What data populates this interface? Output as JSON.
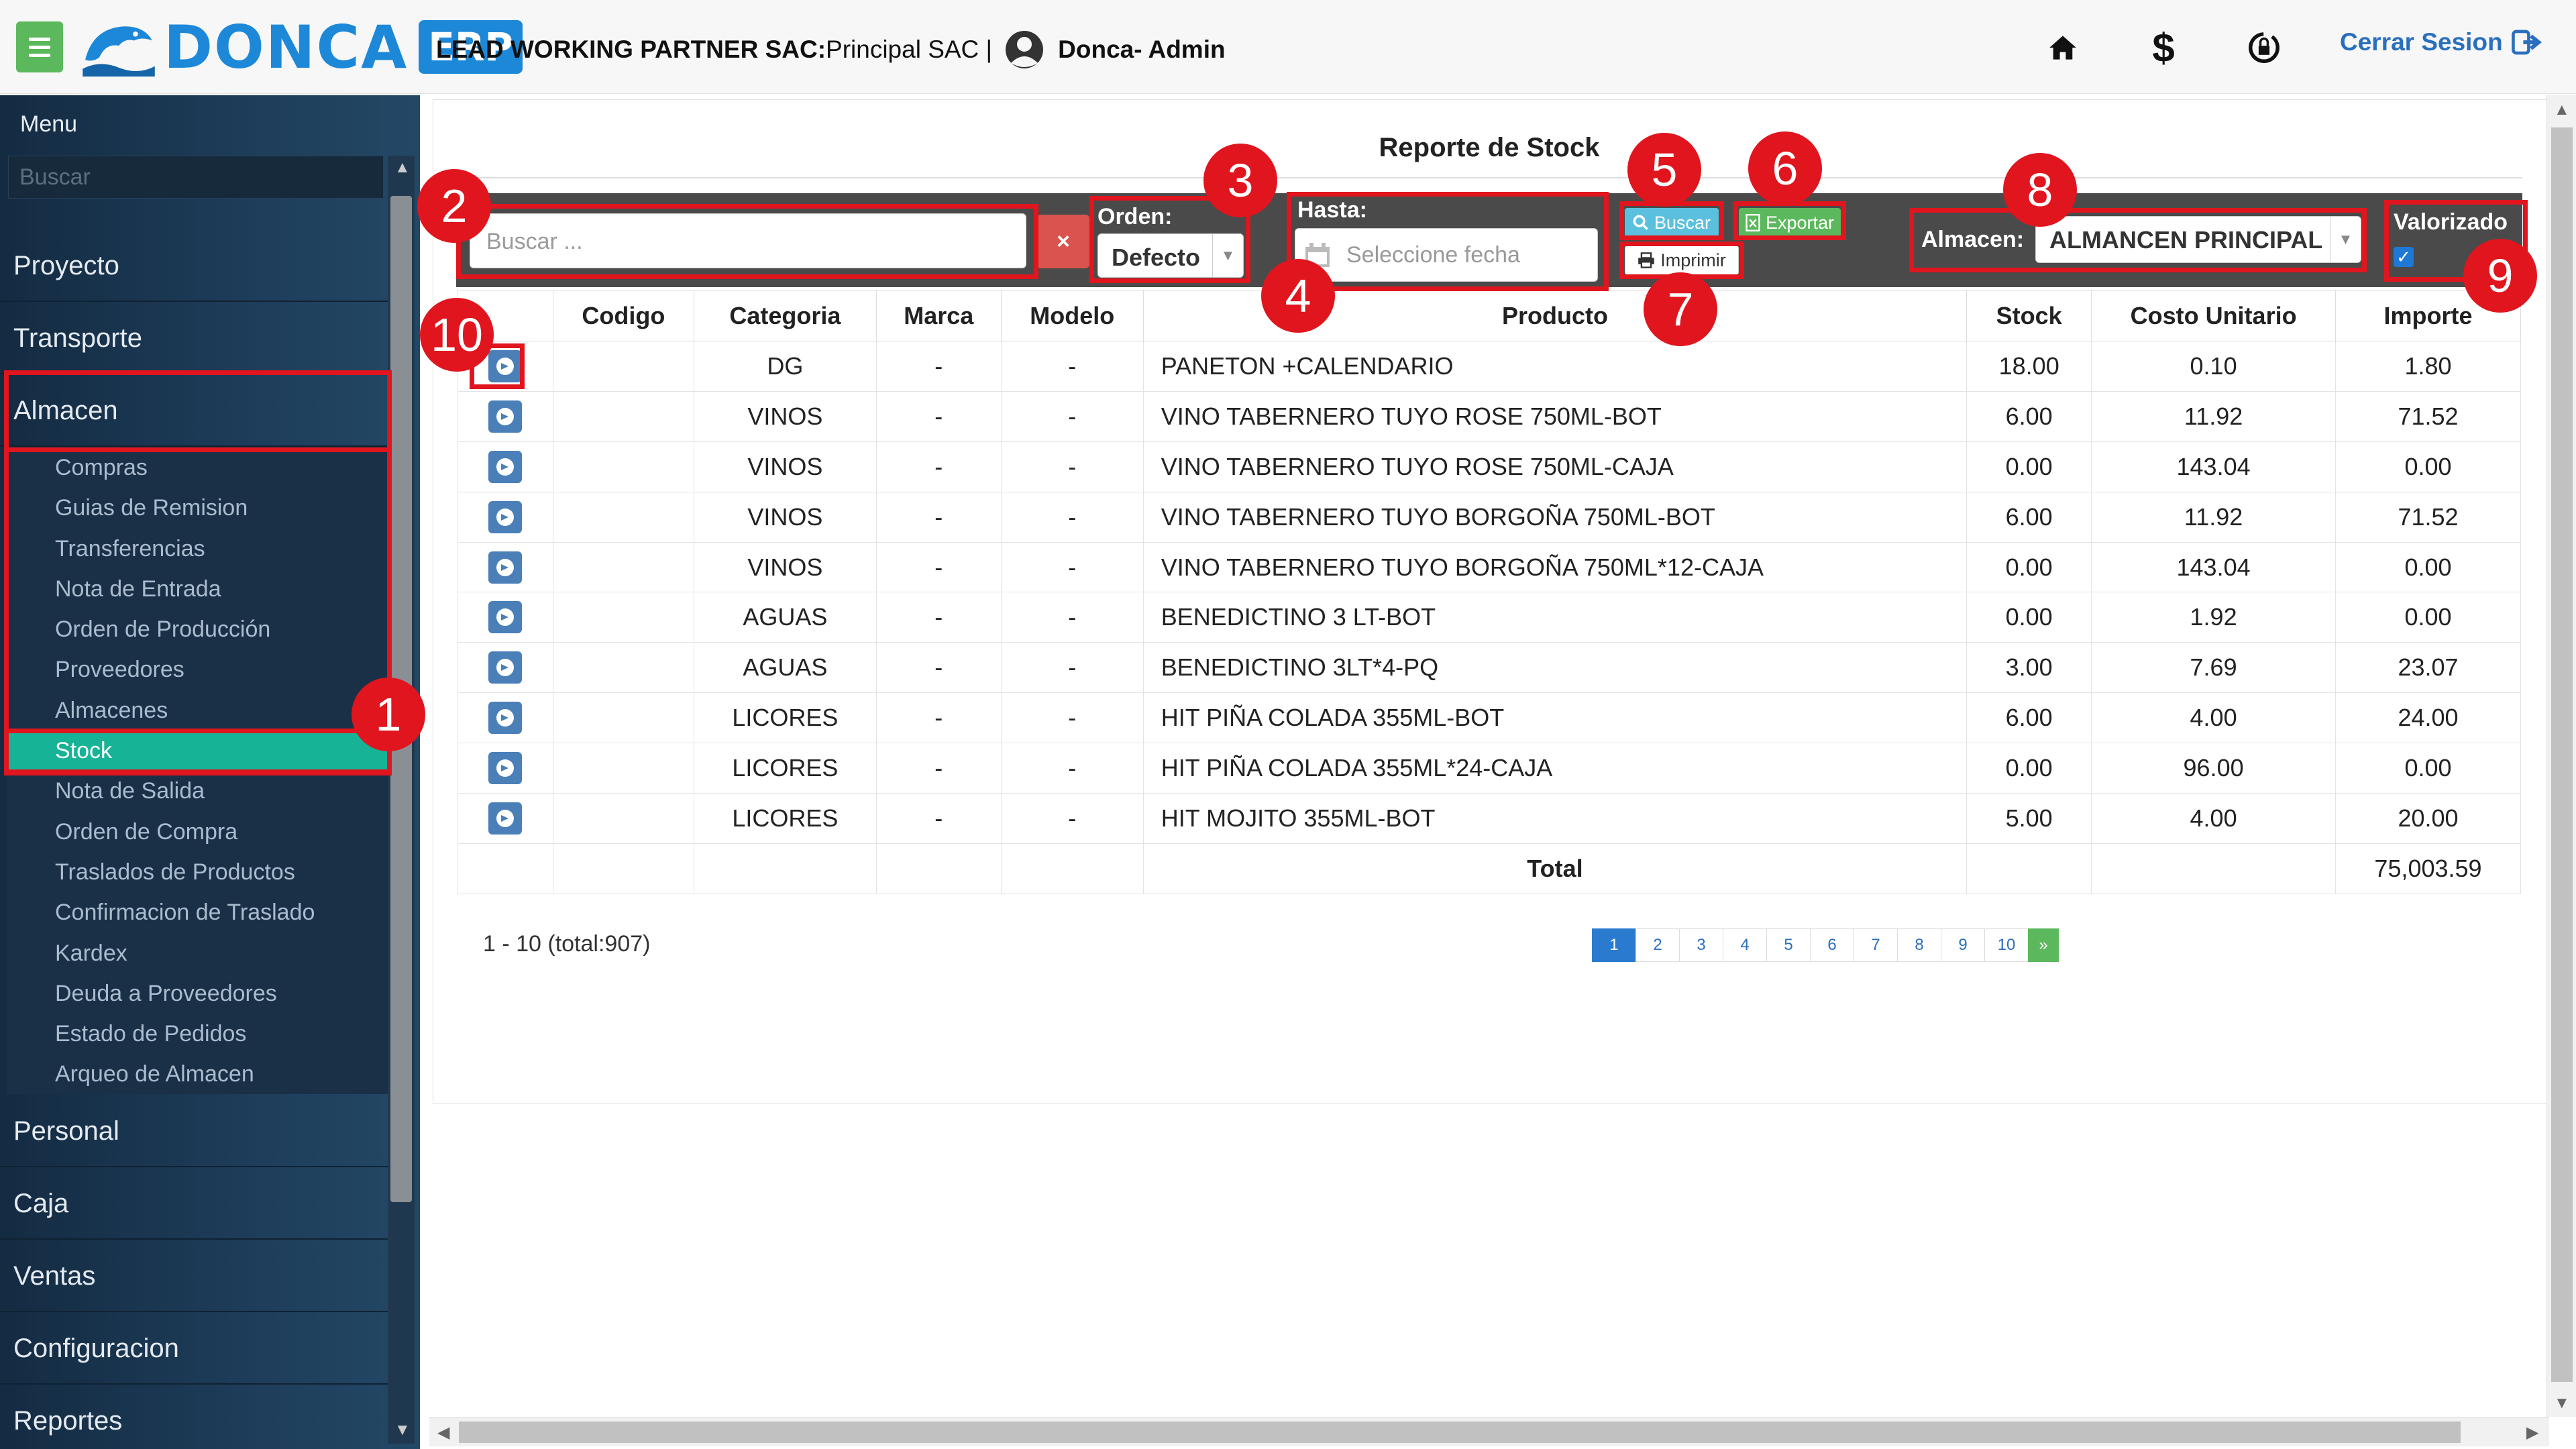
{
  "header": {
    "brand": "DONCA",
    "brand_suffix": "ERP",
    "company_name": "LEAD WORKING PARTNER SAC:",
    "branch": " Principal SAC |",
    "user": "Donca- Admin",
    "logout": "Cerrar Sesion",
    "icons": [
      "home-icon",
      "dollar-icon",
      "sync-lock-icon",
      "sign-out-icon"
    ]
  },
  "sidebar": {
    "title": "Menu",
    "search_placeholder": "Buscar",
    "items": [
      "Proyecto",
      "Transporte",
      "Almacen",
      "Personal",
      "Caja",
      "Ventas",
      "Configuracion",
      "Reportes"
    ],
    "almacen_sub": [
      "Compras",
      "Guias de Remision",
      "Transferencias",
      "Nota de Entrada",
      "Orden de Producción",
      "Proveedores",
      "Almacenes",
      "Stock",
      "Nota de Salida",
      "Orden de Compra",
      "Traslados de Productos",
      "Confirmacion de Traslado",
      "Kardex",
      "Deuda a Proveedores",
      "Estado de Pedidos",
      "Arqueo de Almacen"
    ],
    "active_sub": "Stock"
  },
  "report": {
    "title": "Reporte de Stock",
    "search_placeholder": "Buscar ...",
    "clear_label": "×",
    "orden_label": "Orden:",
    "orden_value": "Defecto",
    "hasta_label": "Hasta:",
    "date_placeholder": "Seleccione fecha",
    "buscar_label": "Buscar",
    "exportar_label": "Exportar",
    "imprimir_label": "Imprimir",
    "almacen_label": "Almacen:",
    "almacen_value": "ALMANCEN PRINCIPAL",
    "valorizado_label": "Valorizado",
    "valorizado_checked": true
  },
  "table": {
    "headers": [
      "",
      "Codigo",
      "Categoria",
      "Marca",
      "Modelo",
      "Producto",
      "Stock",
      "Costo Unitario",
      "Importe"
    ],
    "rows": [
      {
        "codigo": "",
        "categoria": "DG",
        "marca": "-",
        "modelo": "-",
        "producto": "PANETON +CALENDARIO",
        "stock": "18.00",
        "costo": "0.10",
        "importe": "1.80"
      },
      {
        "codigo": "",
        "categoria": "VINOS",
        "marca": "-",
        "modelo": "-",
        "producto": "VINO TABERNERO TUYO ROSE 750ML-BOT",
        "stock": "6.00",
        "costo": "11.92",
        "importe": "71.52"
      },
      {
        "codigo": "",
        "categoria": "VINOS",
        "marca": "-",
        "modelo": "-",
        "producto": "VINO TABERNERO TUYO ROSE 750ML-CAJA",
        "stock": "0.00",
        "costo": "143.04",
        "importe": "0.00"
      },
      {
        "codigo": "",
        "categoria": "VINOS",
        "marca": "-",
        "modelo": "-",
        "producto": "VINO TABERNERO TUYO BORGOÑA 750ML-BOT",
        "stock": "6.00",
        "costo": "11.92",
        "importe": "71.52"
      },
      {
        "codigo": "",
        "categoria": "VINOS",
        "marca": "-",
        "modelo": "-",
        "producto": "VINO TABERNERO TUYO BORGOÑA 750ML*12-CAJA",
        "stock": "0.00",
        "costo": "143.04",
        "importe": "0.00"
      },
      {
        "codigo": "",
        "categoria": "AGUAS",
        "marca": "-",
        "modelo": "-",
        "producto": "BENEDICTINO 3 LT-BOT",
        "stock": "0.00",
        "costo": "1.92",
        "importe": "0.00"
      },
      {
        "codigo": "",
        "categoria": "AGUAS",
        "marca": "-",
        "modelo": "-",
        "producto": "BENEDICTINO 3LT*4-PQ",
        "stock": "3.00",
        "costo": "7.69",
        "importe": "23.07"
      },
      {
        "codigo": "",
        "categoria": "LICORES",
        "marca": "-",
        "modelo": "-",
        "producto": "HIT PIÑA COLADA 355ML-BOT",
        "stock": "6.00",
        "costo": "4.00",
        "importe": "24.00"
      },
      {
        "codigo": "",
        "categoria": "LICORES",
        "marca": "-",
        "modelo": "-",
        "producto": "HIT PIÑA COLADA 355ML*24-CAJA",
        "stock": "0.00",
        "costo": "96.00",
        "importe": "0.00"
      },
      {
        "codigo": "",
        "categoria": "LICORES",
        "marca": "-",
        "modelo": "-",
        "producto": "HIT MOJITO 355ML-BOT",
        "stock": "5.00",
        "costo": "4.00",
        "importe": "20.00"
      }
    ],
    "total_label": "Total",
    "total_value": "75,003.59"
  },
  "pagination": {
    "summary": "1 - 10 (total:907)",
    "pages": [
      "1",
      "2",
      "3",
      "4",
      "5",
      "6",
      "7",
      "8",
      "9",
      "10"
    ],
    "active_page": "1",
    "next_label": "»"
  },
  "markers": [
    "1",
    "2",
    "3",
    "4",
    "5",
    "6",
    "7",
    "8",
    "9",
    "10"
  ],
  "colors": {
    "accent_green": "#5cb85c",
    "brand_blue": "#1e88d8",
    "active_teal": "#17b397",
    "highlight_red": "#e0151e",
    "filter_bar": "#4a4a4a"
  }
}
